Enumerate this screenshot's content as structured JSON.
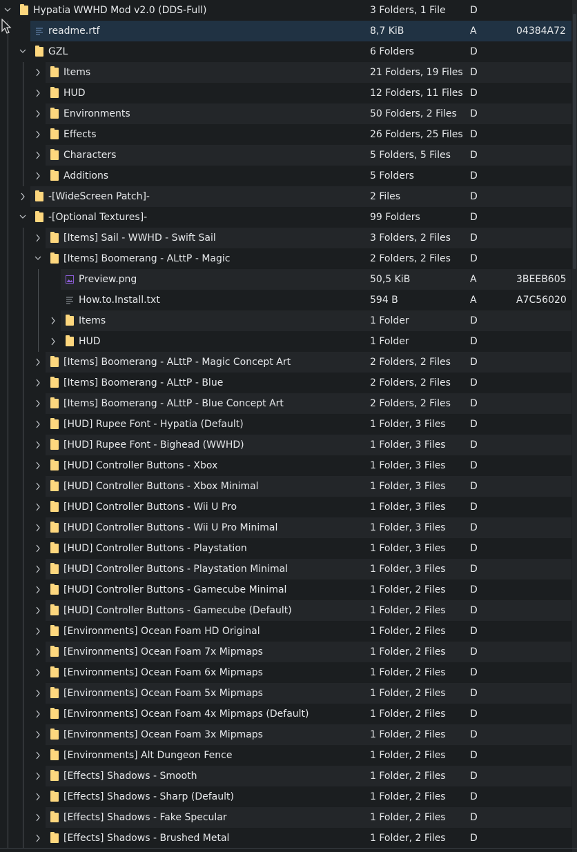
{
  "colors": {
    "background": "#1b1e20",
    "row_alt": "#232629",
    "selected": "#203243",
    "folder": "#fdd77e",
    "text": "#e6e8ea",
    "guide": "#4d5155",
    "image_icon": "#8b5cd6",
    "text_icon": "#9aa0a6"
  },
  "rows": [
    {
      "name": "Hypatia WWHD Mod v2.0 (DDS-Full)",
      "size": "3 Folders, 1 File",
      "attr": "D",
      "crc": "",
      "kind": "folder",
      "depth": 0,
      "expanded": true
    },
    {
      "name": "readme.rtf",
      "size": "8,7 KiB",
      "attr": "A",
      "crc": "04384A72",
      "kind": "rtf",
      "depth": 1,
      "expanded": null,
      "selected": true
    },
    {
      "name": "GZL",
      "size": "6 Folders",
      "attr": "D",
      "crc": "",
      "kind": "folder",
      "depth": 1,
      "expanded": true
    },
    {
      "name": "Items",
      "size": "21 Folders, 19 Files",
      "attr": "D",
      "crc": "",
      "kind": "folder",
      "depth": 2,
      "expanded": false
    },
    {
      "name": "HUD",
      "size": "12 Folders, 11 Files",
      "attr": "D",
      "crc": "",
      "kind": "folder",
      "depth": 2,
      "expanded": false
    },
    {
      "name": "Environments",
      "size": "50 Folders, 2 Files",
      "attr": "D",
      "crc": "",
      "kind": "folder",
      "depth": 2,
      "expanded": false
    },
    {
      "name": "Effects",
      "size": "26 Folders, 25 Files",
      "attr": "D",
      "crc": "",
      "kind": "folder",
      "depth": 2,
      "expanded": false
    },
    {
      "name": "Characters",
      "size": "5 Folders, 5 Files",
      "attr": "D",
      "crc": "",
      "kind": "folder",
      "depth": 2,
      "expanded": false
    },
    {
      "name": "Additions",
      "size": "5 Folders",
      "attr": "D",
      "crc": "",
      "kind": "folder",
      "depth": 2,
      "expanded": false
    },
    {
      "name": "-[WideScreen Patch]-",
      "size": "2 Files",
      "attr": "D",
      "crc": "",
      "kind": "folder",
      "depth": 1,
      "expanded": false
    },
    {
      "name": "-[Optional Textures]-",
      "size": "99 Folders",
      "attr": "D",
      "crc": "",
      "kind": "folder",
      "depth": 1,
      "expanded": true
    },
    {
      "name": "[Items] Sail - WWHD - Swift Sail",
      "size": "3 Folders, 2 Files",
      "attr": "D",
      "crc": "",
      "kind": "folder",
      "depth": 2,
      "expanded": false
    },
    {
      "name": "[Items] Boomerang - ALttP - Magic",
      "size": "2 Folders, 2 Files",
      "attr": "D",
      "crc": "",
      "kind": "folder",
      "depth": 2,
      "expanded": true
    },
    {
      "name": "Preview.png",
      "size": "50,5 KiB",
      "attr": "A",
      "crc": "3BEEB605",
      "kind": "image",
      "depth": 3,
      "expanded": null
    },
    {
      "name": "How.to.Install.txt",
      "size": "594 B",
      "attr": "A",
      "crc": "A7C56020",
      "kind": "text",
      "depth": 3,
      "expanded": null
    },
    {
      "name": "Items",
      "size": "1 Folder",
      "attr": "D",
      "crc": "",
      "kind": "folder",
      "depth": 3,
      "expanded": false
    },
    {
      "name": "HUD",
      "size": "1 Folder",
      "attr": "D",
      "crc": "",
      "kind": "folder",
      "depth": 3,
      "expanded": false
    },
    {
      "name": "[Items] Boomerang - ALttP - Magic Concept Art",
      "size": "2 Folders, 2 Files",
      "attr": "D",
      "crc": "",
      "kind": "folder",
      "depth": 2,
      "expanded": false
    },
    {
      "name": "[Items] Boomerang - ALttP - Blue",
      "size": "2 Folders, 2 Files",
      "attr": "D",
      "crc": "",
      "kind": "folder",
      "depth": 2,
      "expanded": false
    },
    {
      "name": "[Items] Boomerang - ALttP - Blue Concept Art",
      "size": "2 Folders, 2 Files",
      "attr": "D",
      "crc": "",
      "kind": "folder",
      "depth": 2,
      "expanded": false
    },
    {
      "name": "[HUD] Rupee Font - Hypatia (Default)",
      "size": "1 Folder, 3 Files",
      "attr": "D",
      "crc": "",
      "kind": "folder",
      "depth": 2,
      "expanded": false
    },
    {
      "name": "[HUD] Rupee Font - Bighead (WWHD)",
      "size": "1 Folder, 3 Files",
      "attr": "D",
      "crc": "",
      "kind": "folder",
      "depth": 2,
      "expanded": false
    },
    {
      "name": "[HUD] Controller Buttons - Xbox",
      "size": "1 Folder, 3 Files",
      "attr": "D",
      "crc": "",
      "kind": "folder",
      "depth": 2,
      "expanded": false
    },
    {
      "name": "[HUD] Controller Buttons - Xbox Minimal",
      "size": "1 Folder, 3 Files",
      "attr": "D",
      "crc": "",
      "kind": "folder",
      "depth": 2,
      "expanded": false
    },
    {
      "name": "[HUD] Controller Buttons - Wii U Pro",
      "size": "1 Folder, 3 Files",
      "attr": "D",
      "crc": "",
      "kind": "folder",
      "depth": 2,
      "expanded": false
    },
    {
      "name": "[HUD] Controller Buttons - Wii U Pro Minimal",
      "size": "1 Folder, 3 Files",
      "attr": "D",
      "crc": "",
      "kind": "folder",
      "depth": 2,
      "expanded": false
    },
    {
      "name": "[HUD] Controller Buttons - Playstation",
      "size": "1 Folder, 3 Files",
      "attr": "D",
      "crc": "",
      "kind": "folder",
      "depth": 2,
      "expanded": false
    },
    {
      "name": "[HUD] Controller Buttons - Playstation Minimal",
      "size": "1 Folder, 3 Files",
      "attr": "D",
      "crc": "",
      "kind": "folder",
      "depth": 2,
      "expanded": false
    },
    {
      "name": "[HUD] Controller Buttons - Gamecube Minimal",
      "size": "1 Folder, 2 Files",
      "attr": "D",
      "crc": "",
      "kind": "folder",
      "depth": 2,
      "expanded": false
    },
    {
      "name": "[HUD] Controller Buttons - Gamecube (Default)",
      "size": "1 Folder, 2 Files",
      "attr": "D",
      "crc": "",
      "kind": "folder",
      "depth": 2,
      "expanded": false
    },
    {
      "name": "[Environments] Ocean Foam HD Original",
      "size": "1 Folder, 2 Files",
      "attr": "D",
      "crc": "",
      "kind": "folder",
      "depth": 2,
      "expanded": false
    },
    {
      "name": "[Environments] Ocean Foam 7x Mipmaps",
      "size": "1 Folder, 2 Files",
      "attr": "D",
      "crc": "",
      "kind": "folder",
      "depth": 2,
      "expanded": false
    },
    {
      "name": "[Environments] Ocean Foam 6x Mipmaps",
      "size": "1 Folder, 2 Files",
      "attr": "D",
      "crc": "",
      "kind": "folder",
      "depth": 2,
      "expanded": false
    },
    {
      "name": "[Environments] Ocean Foam 5x Mipmaps",
      "size": "1 Folder, 2 Files",
      "attr": "D",
      "crc": "",
      "kind": "folder",
      "depth": 2,
      "expanded": false
    },
    {
      "name": "[Environments] Ocean Foam 4x Mipmaps (Default)",
      "size": "1 Folder, 2 Files",
      "attr": "D",
      "crc": "",
      "kind": "folder",
      "depth": 2,
      "expanded": false
    },
    {
      "name": "[Environments] Ocean Foam 3x Mipmaps",
      "size": "1 Folder, 2 Files",
      "attr": "D",
      "crc": "",
      "kind": "folder",
      "depth": 2,
      "expanded": false
    },
    {
      "name": "[Environments] Alt Dungeon Fence",
      "size": "1 Folder, 2 Files",
      "attr": "D",
      "crc": "",
      "kind": "folder",
      "depth": 2,
      "expanded": false
    },
    {
      "name": "[Effects] Shadows - Smooth",
      "size": "1 Folder, 2 Files",
      "attr": "D",
      "crc": "",
      "kind": "folder",
      "depth": 2,
      "expanded": false
    },
    {
      "name": "[Effects] Shadows - Sharp (Default)",
      "size": "1 Folder, 2 Files",
      "attr": "D",
      "crc": "",
      "kind": "folder",
      "depth": 2,
      "expanded": false
    },
    {
      "name": "[Effects] Shadows - Fake Specular",
      "size": "1 Folder, 2 Files",
      "attr": "D",
      "crc": "",
      "kind": "folder",
      "depth": 2,
      "expanded": false
    },
    {
      "name": "[Effects] Shadows - Brushed Metal",
      "size": "1 Folder, 2 Files",
      "attr": "D",
      "crc": "",
      "kind": "folder",
      "depth": 2,
      "expanded": false
    }
  ]
}
